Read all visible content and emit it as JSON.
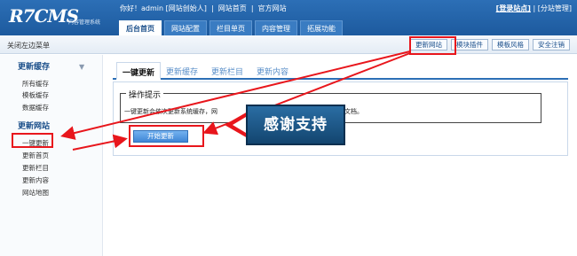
{
  "header": {
    "logo": "R7CMS",
    "logo_sub": "内容管理系统",
    "user_text": "你好！admin [网站创始人]",
    "site_home": "网站首页",
    "official_site": "官方网站",
    "login_site": "[登录站点]",
    "site_manage": "[分站管理]",
    "tabs": [
      {
        "label": "后台首页",
        "active": true
      },
      {
        "label": "网站配置",
        "active": false
      },
      {
        "label": "栏目单页",
        "active": false
      },
      {
        "label": "内容管理",
        "active": false
      },
      {
        "label": "拓展功能",
        "active": false
      }
    ]
  },
  "subbar": {
    "close_menu": "关闭左边菜单",
    "buttons": [
      "更新网站",
      "模块插件",
      "模板风格",
      "安全注销"
    ]
  },
  "sidebar": {
    "cache_title": "更新缓存",
    "cache_items": [
      "所有缓存",
      "模板缓存",
      "数据缓存"
    ],
    "update_title": "更新网站",
    "update_items": [
      "一键更新",
      "更新首页",
      "更新栏目",
      "更新内容",
      "网站地图"
    ]
  },
  "main": {
    "tabs": [
      "一键更新",
      "更新缓存",
      "更新栏目",
      "更新内容"
    ],
    "legend": "操作提示",
    "hint": "一键更新会依次更新系统缓存，网",
    "hint_tail": "文档。",
    "start_button": "开始更新"
  },
  "badge": {
    "text": "感谢支持"
  },
  "colors": {
    "header_blue": "#2c6fb6",
    "highlight_red": "#e8161c",
    "link_blue": "#1b4f8a"
  }
}
